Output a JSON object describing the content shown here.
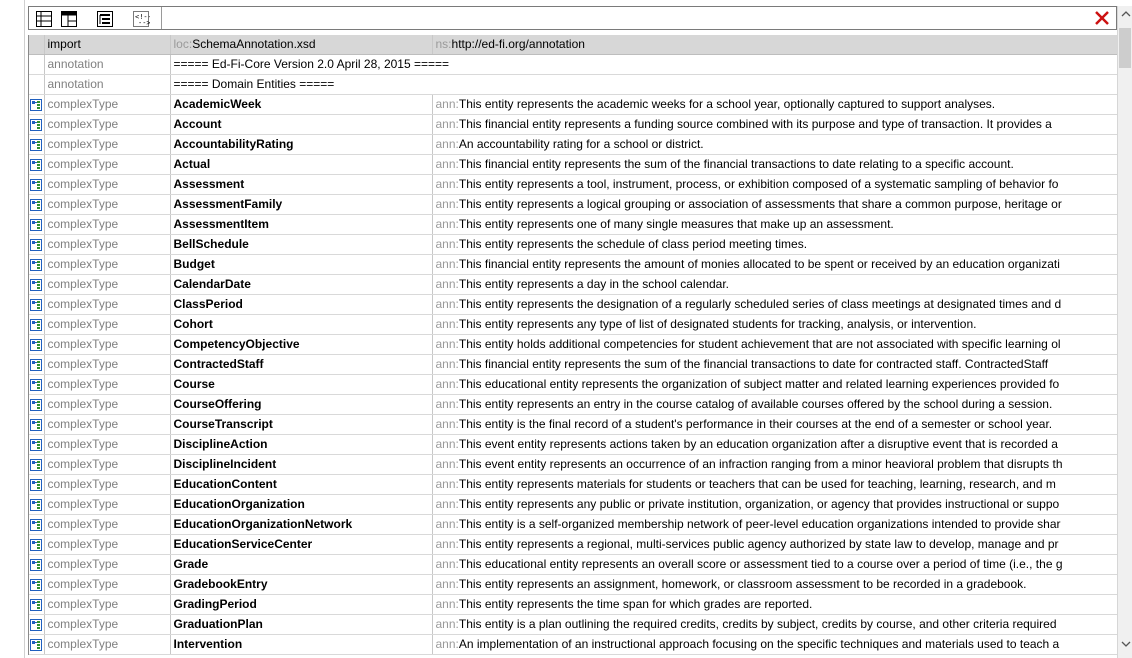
{
  "toolbar": {
    "buttons": [
      "grid-view-icon",
      "table-view-icon",
      "tree-view-icon",
      "comment-icon"
    ],
    "close": "close-icon"
  },
  "rows_header": [
    {
      "kind": "import",
      "name_prefix": "loc:",
      "name": "SchemaAnnotation.xsd",
      "desc_prefix": "ns:",
      "desc": "http://ed-fi.org/annotation"
    },
    {
      "kind": "annotation",
      "name": "===== Ed-Fi-Core Version 2.0 April 28, 2015 ====="
    },
    {
      "kind": "annotation",
      "name": "===== Domain Entities ====="
    }
  ],
  "ann_prefix": "ann:",
  "types": [
    {
      "kind": "complexType",
      "name": "AcademicWeek",
      "desc": "This entity represents the academic weeks for a school year, optionally captured to support analyses."
    },
    {
      "kind": "complexType",
      "name": "Account",
      "desc": "This financial entity represents a funding source combined with its purpose and type of transaction. It provides a"
    },
    {
      "kind": "complexType",
      "name": "AccountabilityRating",
      "desc": "An accountability rating for a school or district."
    },
    {
      "kind": "complexType",
      "name": "Actual",
      "desc": "This financial entity represents the sum of the financial transactions to date relating to a specific account."
    },
    {
      "kind": "complexType",
      "name": "Assessment",
      "desc": "This entity represents a tool, instrument, process, or exhibition composed of a systematic sampling of behavior fo"
    },
    {
      "kind": "complexType",
      "name": "AssessmentFamily",
      "desc": "This entity represents a logical grouping or association of assessments that share a common purpose, heritage or"
    },
    {
      "kind": "complexType",
      "name": "AssessmentItem",
      "desc": "This entity represents one of many single measures that make up an assessment."
    },
    {
      "kind": "complexType",
      "name": "BellSchedule",
      "desc": "This entity represents the schedule of class period meeting times."
    },
    {
      "kind": "complexType",
      "name": "Budget",
      "desc": "This financial entity represents the amount of monies allocated to be spent or received by an education organizati"
    },
    {
      "kind": "complexType",
      "name": "CalendarDate",
      "desc": "This entity represents a day in the school calendar."
    },
    {
      "kind": "complexType",
      "name": "ClassPeriod",
      "desc": "This entity represents the designation of a regularly scheduled series of class meetings at designated times and d"
    },
    {
      "kind": "complexType",
      "name": "Cohort",
      "desc": "This entity represents any type of list of designated students for tracking, analysis, or intervention."
    },
    {
      "kind": "complexType",
      "name": "CompetencyObjective",
      "desc": "This entity holds additional competencies for student achievement that are not associated with specific learning ol"
    },
    {
      "kind": "complexType",
      "name": "ContractedStaff",
      "desc": "This financial entity represents the sum of the financial transactions to date for contracted staff. ContractedStaff"
    },
    {
      "kind": "complexType",
      "name": "Course",
      "desc": "This educational entity represents the organization of subject matter and related learning experiences provided fo"
    },
    {
      "kind": "complexType",
      "name": "CourseOffering",
      "desc": "This entity represents an entry in the course catalog of available courses offered by the school during a session."
    },
    {
      "kind": "complexType",
      "name": "CourseTranscript",
      "desc": "This entity is the final record of a student's performance in their courses at the end of a semester or school year."
    },
    {
      "kind": "complexType",
      "name": "DisciplineAction",
      "desc": "This event entity represents actions taken by an education organization after a disruptive event that is recorded a"
    },
    {
      "kind": "complexType",
      "name": "DisciplineIncident",
      "desc": "This event entity represents an occurrence of an infraction ranging from a minor heavioral problem that disrupts th"
    },
    {
      "kind": "complexType",
      "name": "EducationContent",
      "desc": "This entity represents materials for students or teachers that can be used for teaching, learning, research, and m"
    },
    {
      "kind": "complexType",
      "name": "EducationOrganization",
      "desc": "This entity represents any public or private institution, organization, or agency that provides instructional or suppo"
    },
    {
      "kind": "complexType",
      "name": "EducationOrganizationNetwork",
      "desc": "This entity is a self-organized membership network of peer-level education organizations intended to provide shar"
    },
    {
      "kind": "complexType",
      "name": "EducationServiceCenter",
      "desc": "This entity represents a regional, multi-services public agency authorized by state law to develop, manage and pr"
    },
    {
      "kind": "complexType",
      "name": "Grade",
      "desc": "This educational entity represents an overall score or assessment tied to a course over a period of time (i.e., the g"
    },
    {
      "kind": "complexType",
      "name": "GradebookEntry",
      "desc": "This entity represents an assignment, homework, or classroom assessment to be recorded in a gradebook."
    },
    {
      "kind": "complexType",
      "name": "GradingPeriod",
      "desc": "This entity represents the time span for which grades are reported."
    },
    {
      "kind": "complexType",
      "name": "GraduationPlan",
      "desc": "This entity is a plan outlining the required credits, credits by subject, credits by course, and other criteria required"
    },
    {
      "kind": "complexType",
      "name": "Intervention",
      "desc": "An implementation of an instructional approach focusing on the specific techniques and materials used to teach a"
    }
  ],
  "colors": {
    "import_row": "#d7d7d7",
    "kind_text": "#808080",
    "close_red": "#cc1111",
    "icon_blue": "#1f5fbf",
    "icon_green": "#2f8f2f"
  }
}
